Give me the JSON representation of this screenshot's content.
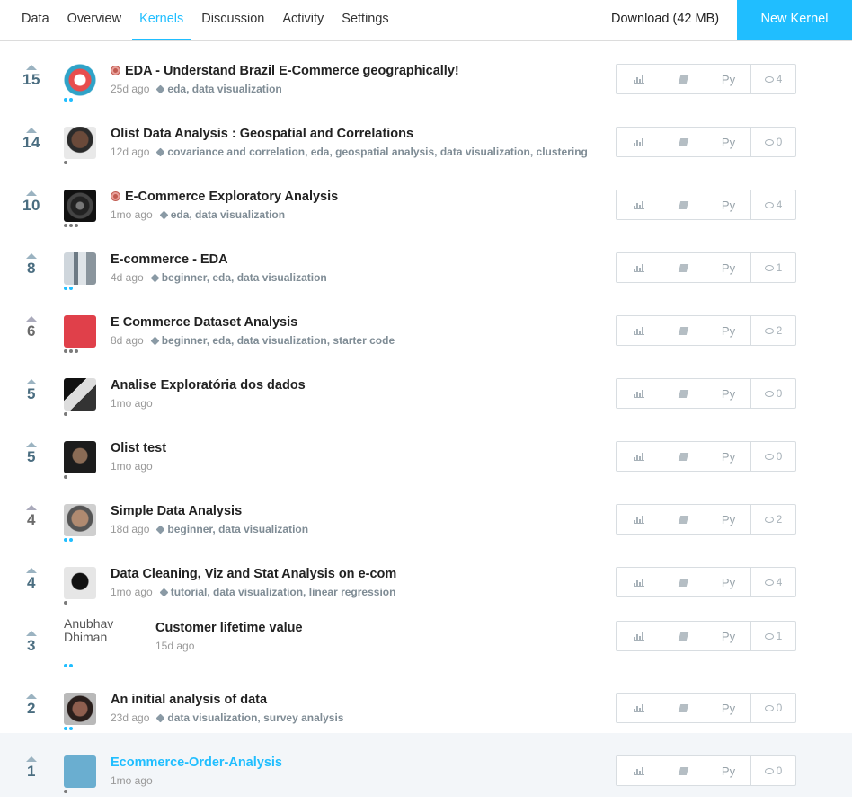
{
  "nav": {
    "tabs": [
      "Data",
      "Overview",
      "Kernels",
      "Discussion",
      "Activity",
      "Settings"
    ],
    "active_tab": "Kernels",
    "download_label": "Download (42 MB)",
    "new_kernel_label": "New Kernel"
  },
  "colors": {
    "accent": "#20BEFF",
    "vote": "#4a6d80",
    "tag": "#7f8c95"
  },
  "kernels": [
    {
      "votes": "15",
      "medal": true,
      "title": "EDA - Understand Brazil E-Commerce geographically!",
      "age": "25d ago",
      "tags": "eda, data visualization",
      "comments": "4",
      "lang": "Py",
      "tier": "blue2",
      "avatar": "ring-logo"
    },
    {
      "votes": "14",
      "medal": false,
      "title": "Olist Data Analysis : Geospatial and Correlations",
      "age": "12d ago",
      "tags": "covariance and correlation, eda, geospatial analysis, data visualization, clustering",
      "comments": "0",
      "lang": "Py",
      "tier": "gray1",
      "avatar": "person-photo"
    },
    {
      "votes": "10",
      "medal": true,
      "title": "E-Commerce Exploratory Analysis",
      "age": "1mo ago",
      "tags": "eda, data visualization",
      "comments": "4",
      "lang": "Py",
      "tier": "gray3",
      "avatar": "dark-pattern"
    },
    {
      "votes": "8",
      "medal": false,
      "title": "E-commerce - EDA",
      "age": "4d ago",
      "tags": "beginner, eda, data visualization",
      "comments": "1",
      "lang": "Py",
      "tier": "blue2",
      "avatar": "building-photo"
    },
    {
      "votes": "6",
      "medal": false,
      "title": "E Commerce Dataset Analysis",
      "age": "8d ago",
      "tags": "beginner, eda, data visualization, starter code",
      "comments": "2",
      "lang": "Py",
      "tier": "gray3",
      "avatar": "red-square"
    },
    {
      "votes": "5",
      "medal": false,
      "title": "Analise Exploratória dos dados",
      "age": "1mo ago",
      "tags": "",
      "comments": "0",
      "lang": "Py",
      "tier": "gray1",
      "avatar": "bw-photo"
    },
    {
      "votes": "5",
      "medal": false,
      "title": "Olist test",
      "age": "1mo ago",
      "tags": "",
      "comments": "0",
      "lang": "Py",
      "tier": "gray1",
      "avatar": "person-dark"
    },
    {
      "votes": "4",
      "medal": false,
      "title": "Simple Data Analysis",
      "age": "18d ago",
      "tags": "beginner, data visualization",
      "comments": "2",
      "lang": "Py",
      "tier": "blue2",
      "avatar": "person-face"
    },
    {
      "votes": "4",
      "medal": false,
      "title": "Data Cleaning, Viz and Stat Analysis on e-com",
      "age": "1mo ago",
      "tags": "tutorial, data visualization, linear regression",
      "comments": "4",
      "lang": "Py",
      "tier": "gray1",
      "avatar": "silhouette"
    },
    {
      "votes": "3",
      "medal": false,
      "title": "Customer lifetime value",
      "age": "15d ago",
      "tags": "",
      "comments": "1",
      "lang": "Py",
      "tier": "blue2",
      "avatar": "broken-image",
      "avatar_alt": "Anubhav Dhiman"
    },
    {
      "votes": "2",
      "medal": false,
      "title": "An initial analysis of data",
      "age": "23d ago",
      "tags": "data visualization, survey analysis",
      "comments": "0",
      "lang": "Py",
      "tier": "blue2",
      "avatar": "person-hair"
    },
    {
      "votes": "1",
      "medal": false,
      "title": "Ecommerce-Order-Analysis",
      "age": "1mo ago",
      "tags": "",
      "comments": "0",
      "lang": "Py",
      "tier": "gray1",
      "avatar": "blue-default"
    }
  ]
}
